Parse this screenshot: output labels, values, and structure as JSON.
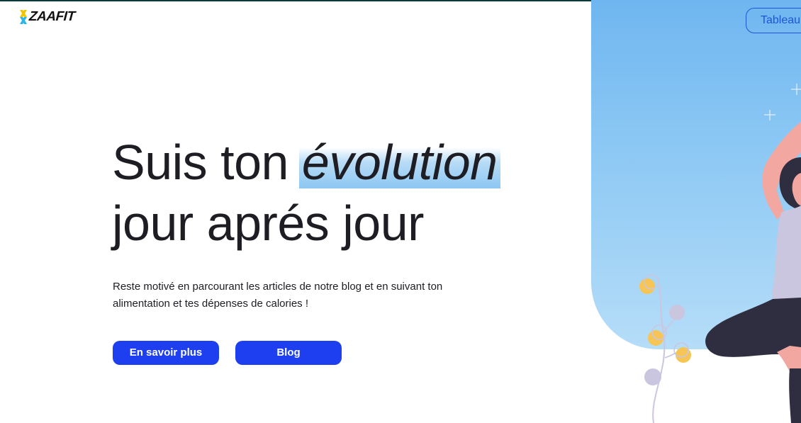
{
  "header": {
    "logo_text": "ZAAFIT",
    "dashboard_label": "Tableau"
  },
  "hero": {
    "title_line1_start": "Suis ton ",
    "title_highlight": "évolution",
    "title_line2": "jour aprés jour",
    "subtitle_line1": "Reste motivé en parcourant les articles de notre blog et en suivant ton",
    "subtitle_line2": "alimentation et tes dépenses de calories !",
    "more_label": "En savoir plus",
    "blog_label": "Blog"
  },
  "colors": {
    "primary": "#1d3ff0",
    "outline": "#1a56d6",
    "sky_top": "#6fb6f0",
    "sky_bottom": "#b6ddf8",
    "text": "#1d1d23",
    "logo_accent_yellow": "#f5c400",
    "logo_accent_blue": "#2bb6e8"
  },
  "icons": {
    "logo_mark": "zaafit-x-logo-icon"
  }
}
